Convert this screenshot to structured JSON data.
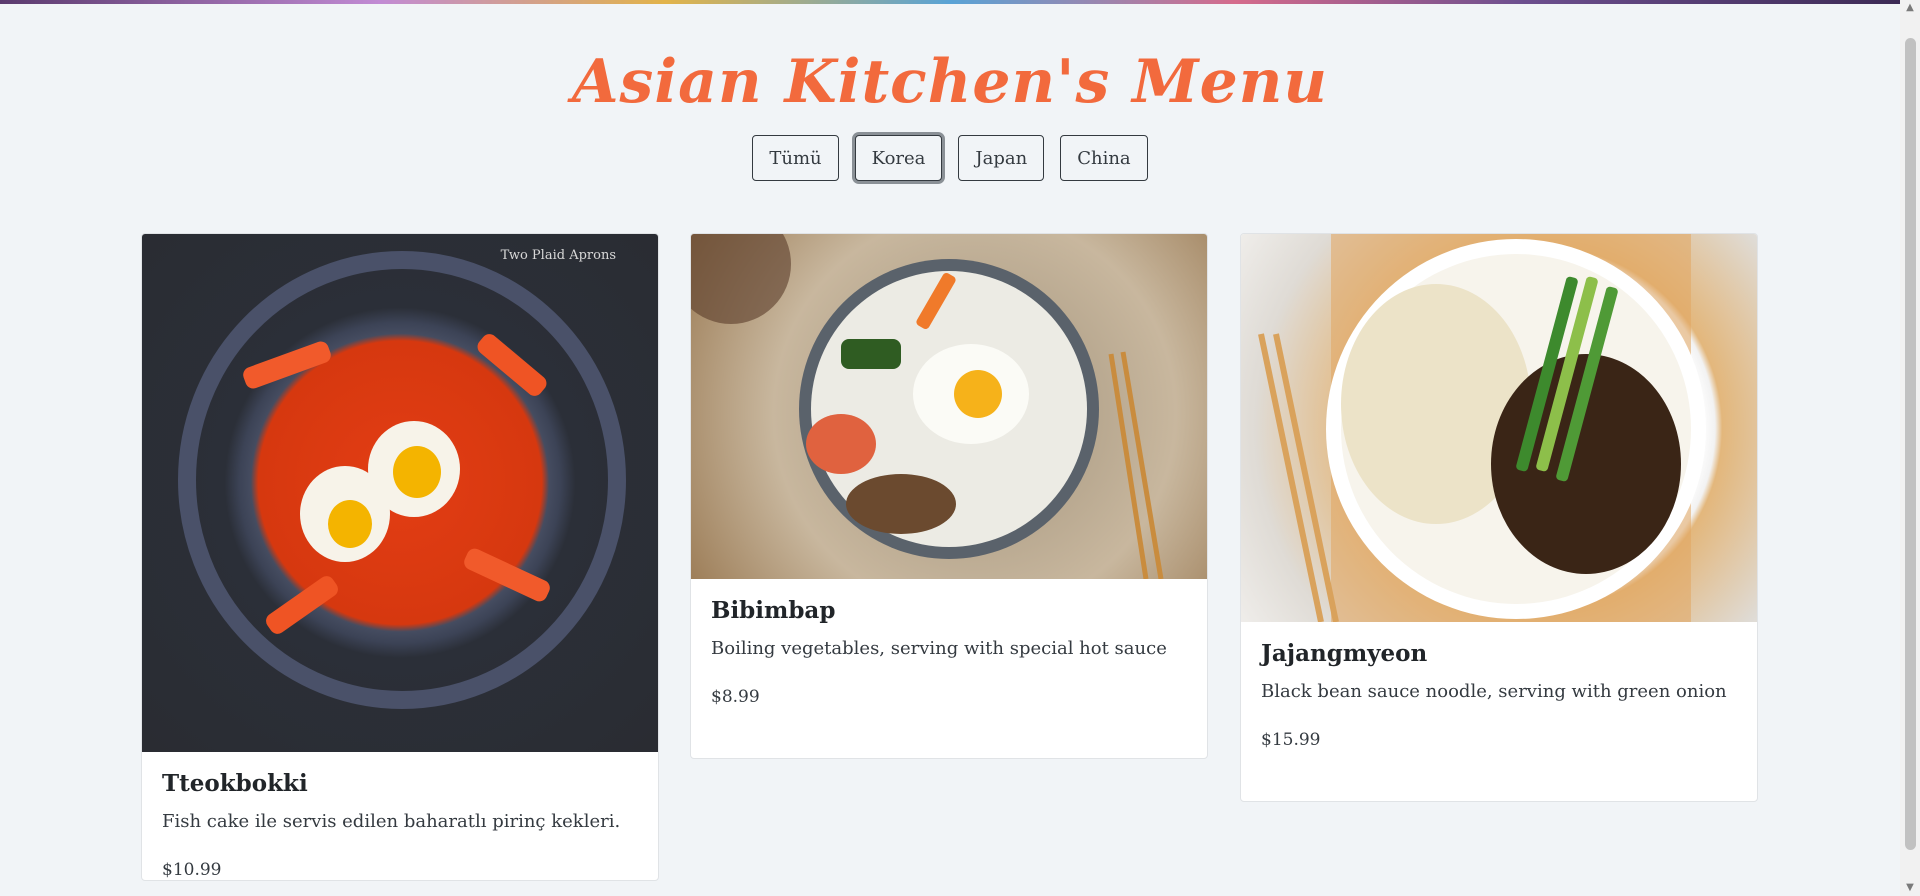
{
  "header": {
    "title": "Asian Kitchen's Menu"
  },
  "filters": [
    {
      "label": "Tümü",
      "active": false
    },
    {
      "label": "Korea",
      "active": true
    },
    {
      "label": "Japan",
      "active": false
    },
    {
      "label": "China",
      "active": false
    }
  ],
  "cards": [
    {
      "title": "Tteokbokki",
      "desc": "Fish cake ile servis edilen baharatlı pirinç kekleri.",
      "price": "$10.99",
      "image_caption": "Two Plaid Aprons"
    },
    {
      "title": "Bibimbap",
      "desc": "Boiling vegetables, serving with special hot sauce",
      "price": "$8.99"
    },
    {
      "title": "Jajangmyeon",
      "desc": "Black bean sauce noodle, serving with green onion",
      "price": "$15.99"
    }
  ],
  "scrollbar": {
    "up_icon": "triangle-up-icon",
    "down_icon": "triangle-down-icon"
  }
}
